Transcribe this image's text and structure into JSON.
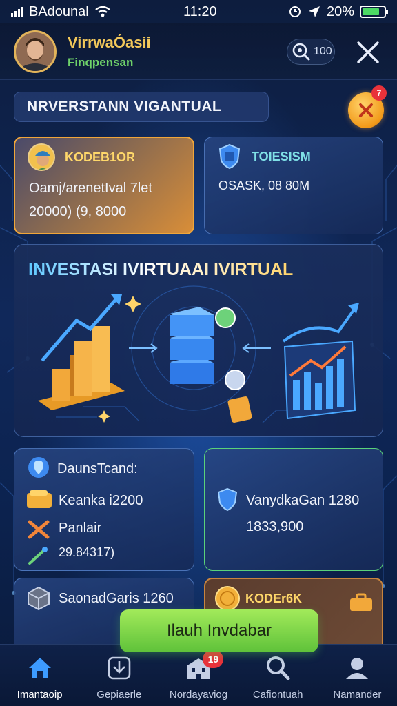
{
  "status_bar": {
    "carrier": "BAdounal",
    "time": "11:20",
    "battery": "20%"
  },
  "header": {
    "app_name": "VirrwaÓasii",
    "subtitle": "Finqpensan",
    "search_count": "100"
  },
  "banner": {
    "title": "NRVERSTANN VIGANTUAL",
    "notification_count": "7"
  },
  "top_cards": [
    {
      "title": "KODEB1OR",
      "line1": "Oamj/arenetIval 7let",
      "line2": "20000) (9, 8000"
    },
    {
      "title": "TOIESISM",
      "line1": "OSASK, 08 80M"
    }
  ],
  "hero": {
    "title": "INVESTASI  IVIRTUAAI IVIRTUAL"
  },
  "mid_cards": [
    {
      "title": "DaunsTcand:",
      "rows": [
        {
          "text": "Keanka i2200"
        },
        {
          "text": "Panlair"
        },
        {
          "text": "29.84317)"
        }
      ]
    },
    {
      "line1": "VanydkaGan 1280",
      "line2": "1833,900"
    }
  ],
  "bottom_cards": [
    {
      "title": "SaonadGaris 1260"
    },
    {
      "title": "KODEr6K"
    }
  ],
  "cta": {
    "label": "Ilauh Invdabar"
  },
  "tab_bar": {
    "items": [
      {
        "label": "Imantaoip"
      },
      {
        "label": "Gepiaerle"
      },
      {
        "label": "Nordayaviog",
        "badge": "19"
      },
      {
        "label": "Cafiontuah"
      },
      {
        "label": "Namander"
      }
    ]
  },
  "colors": {
    "accent_gold": "#f0a63a",
    "accent_green": "#6fd26a",
    "accent_blue": "#4aa8ff",
    "badge_red": "#e8323a"
  }
}
